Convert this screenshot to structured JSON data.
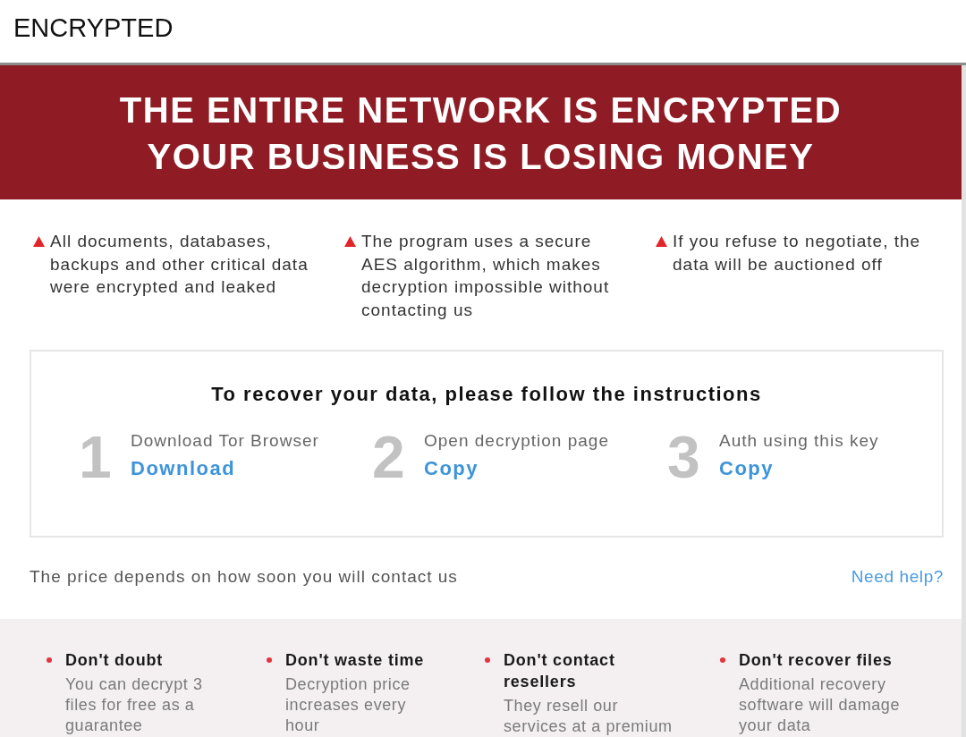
{
  "header": {
    "title": "ENCRYPTED"
  },
  "banner": {
    "lines": [
      "THE ENTIRE NETWORK IS ENCRYPTED",
      "YOUR BUSINESS IS LOSING MONEY"
    ]
  },
  "warnings": [
    {
      "text": "All documents, databases, backups and other critical data were encrypted and leaked"
    },
    {
      "text": "The program uses a secure AES algorithm, which makes decryption impossible without contacting us"
    },
    {
      "text": "If you refuse to negotiate, the data will be auctioned off"
    }
  ],
  "instructions": {
    "title": "To recover your data, please follow the instructions",
    "steps": [
      {
        "number": "1",
        "label": "Download Tor Browser",
        "action": "Download"
      },
      {
        "number": "2",
        "label": "Open decryption page",
        "action": "Copy"
      },
      {
        "number": "3",
        "label": "Auth using this key",
        "action": "Copy"
      }
    ]
  },
  "price_note": "The price depends on how soon you will contact us",
  "help_link": "Need help?",
  "tips": [
    {
      "title": "Don't doubt",
      "text": "You can decrypt 3 files for free as a guarantee"
    },
    {
      "title": "Don't waste time",
      "text": "Decryption price increases every hour"
    },
    {
      "title": "Don't contact resellers",
      "text": "They resell our services at a premium"
    },
    {
      "title": "Don't recover files",
      "text": "Additional recovery software will damage your data"
    }
  ]
}
